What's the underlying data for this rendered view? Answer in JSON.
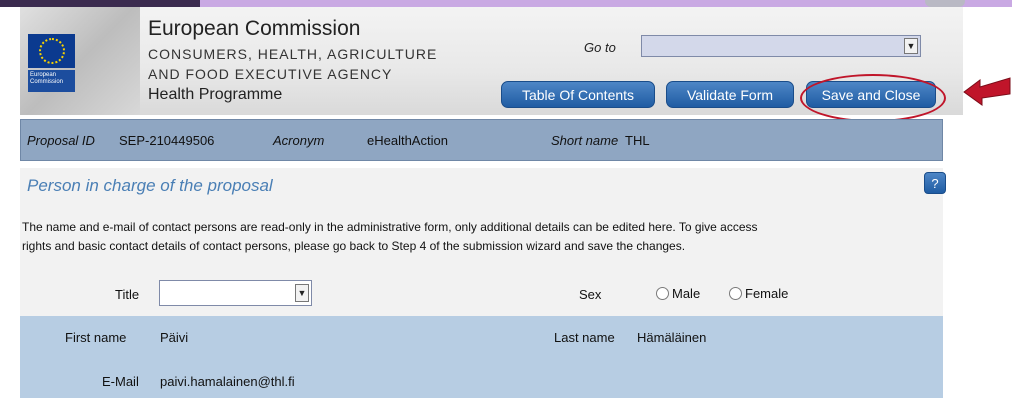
{
  "header": {
    "logo_text": "European Commission",
    "title": "European Commission",
    "agency_line1": "CONSUMERS, HEALTH, AGRICULTURE",
    "agency_line2": "AND FOOD EXECUTIVE AGENCY",
    "programme": "Health Programme",
    "goto_label": "Go to",
    "goto_value": "",
    "buttons": {
      "toc": "Table Of Contents",
      "validate": "Validate Form",
      "save_close": "Save and Close"
    }
  },
  "proposal": {
    "id_label": "Proposal ID",
    "id_value": "SEP-210449506",
    "acronym_label": "Acronym",
    "acronym_value": "eHealthAction",
    "short_name_label": "Short name",
    "short_name_value": "THL"
  },
  "section": {
    "title": "Person in charge of the proposal",
    "help_label": "?",
    "notice_line1": "The name and e-mail of contact persons are read-only in the administrative form, only additional details can be edited here. To give access",
    "notice_line2": "rights and basic contact details of contact persons, please go back to Step 4 of the submission wizard and save the changes."
  },
  "form": {
    "title_label": "Title",
    "title_value": "",
    "sex_label": "Sex",
    "sex_options": [
      "Male",
      "Female"
    ],
    "first_name_label": "First name",
    "first_name_value": "Päivi",
    "last_name_label": "Last name",
    "last_name_value": "Hämäläinen",
    "email_label": "E-Mail",
    "email_value": "paivi.hamalainen@thl.fi"
  },
  "colors": {
    "accent_button": "#1f5ca3",
    "info_bar": "#8fa6c2",
    "field_row": "#b7cde3",
    "annotation_red": "#c0152a"
  }
}
